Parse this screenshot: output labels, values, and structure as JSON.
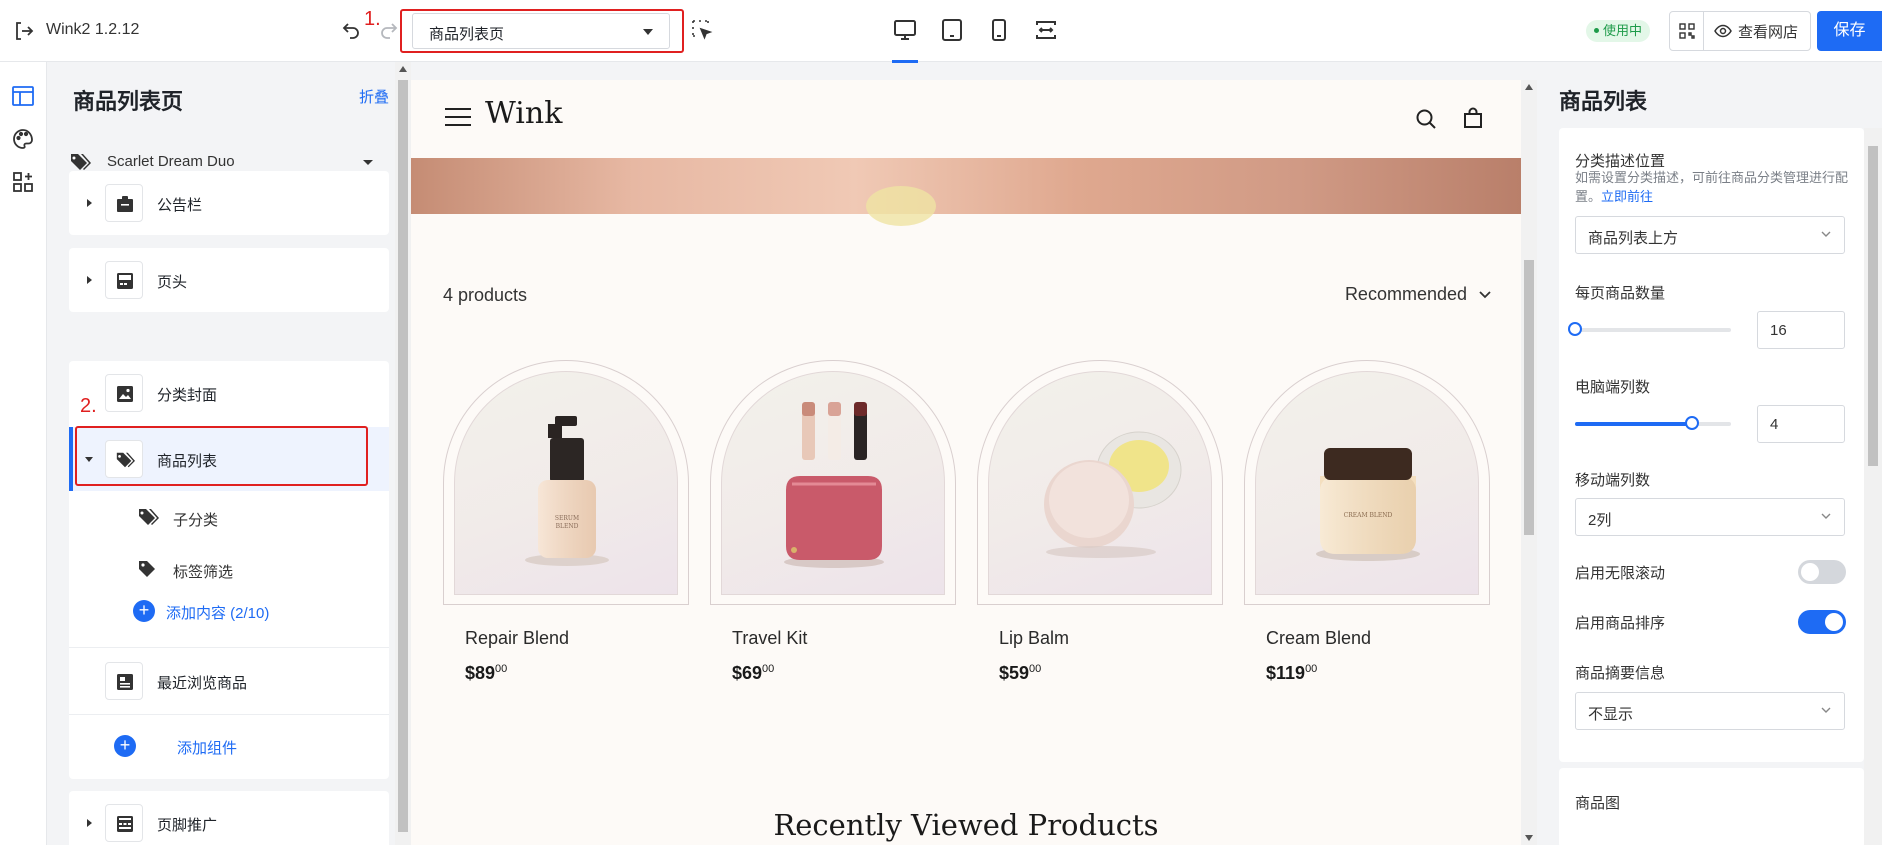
{
  "topbar": {
    "app_title": "Wink2 1.2.12",
    "page_select_value": "商品列表页",
    "status_badge": "使用中",
    "view_store_label": "查看网店",
    "save_label": "保存"
  },
  "annotations": {
    "step1": "1.",
    "step2": "2."
  },
  "left_panel": {
    "title": "商品列表页",
    "collapse_label": "折叠",
    "theme_name": "Scarlet Dream Duo",
    "sections": [
      {
        "label": "公告栏"
      },
      {
        "label": "页头"
      },
      {
        "label": "分类封面"
      },
      {
        "label": "商品列表"
      },
      {
        "label": "最近浏览商品"
      },
      {
        "label": "页脚推广"
      }
    ],
    "sub_items": [
      {
        "label": "子分类"
      },
      {
        "label": "标签筛选"
      }
    ],
    "add_content_label": "添加内容 (2/10)",
    "add_component_label": "添加组件"
  },
  "preview": {
    "brand": "Wink",
    "product_count": "4 products",
    "sort_label": "Recommended",
    "products": [
      {
        "name": "Repair Blend",
        "price": "$89",
        "cents": "00"
      },
      {
        "name": "Travel Kit",
        "price": "$69",
        "cents": "00"
      },
      {
        "name": "Lip Balm",
        "price": "$59",
        "cents": "00"
      },
      {
        "name": "Cream Blend",
        "price": "$119",
        "cents": "00"
      }
    ],
    "recently_viewed_title": "Recently Viewed Products"
  },
  "right_panel": {
    "title": "商品列表",
    "category_desc_label": "分类描述位置",
    "category_desc_hint": "如需设置分类描述，可前往商品分类管理进行配置。",
    "category_desc_link": "立即前往",
    "category_desc_value": "商品列表上方",
    "per_page_label": "每页商品数量",
    "per_page_value": "16",
    "per_page_level": 0.0,
    "desktop_cols_label": "电脑端列数",
    "desktop_cols_value": "4",
    "desktop_cols_level": 0.75,
    "mobile_cols_label": "移动端列数",
    "mobile_cols_value": "2列",
    "infinite_scroll_label": "启用无限滚动",
    "infinite_scroll_on": false,
    "sorting_label": "启用商品排序",
    "sorting_on": true,
    "summary_label": "商品摘要信息",
    "summary_value": "不显示",
    "product_image_label": "商品图"
  },
  "colors": {
    "accent": "#1e6bf4",
    "annotation": "#e02020",
    "badge_green": "#1e9b4a"
  }
}
